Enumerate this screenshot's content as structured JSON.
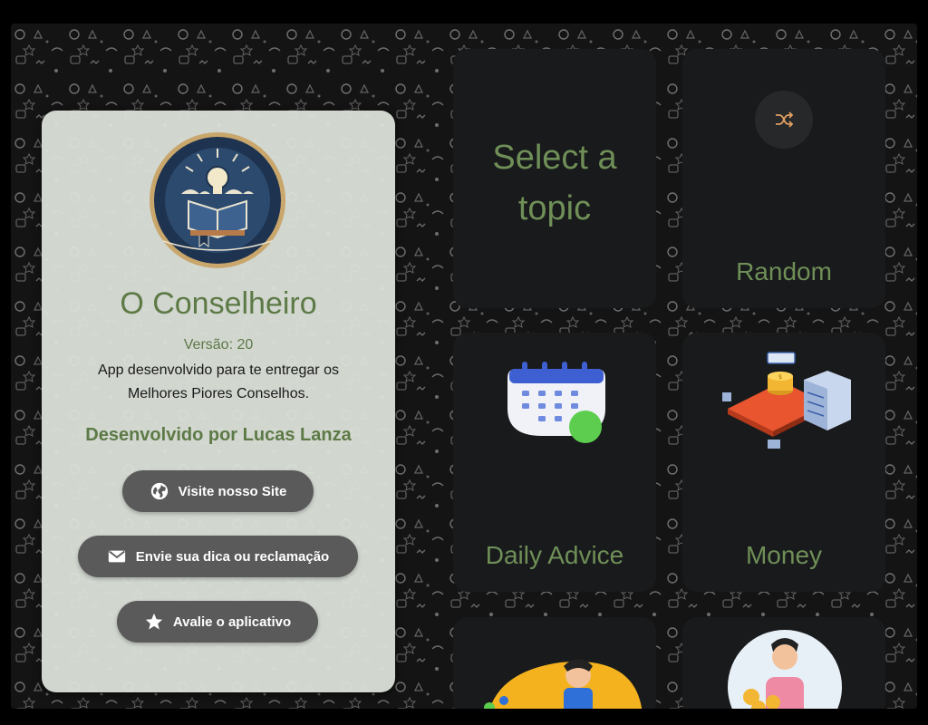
{
  "about": {
    "app_name": "O Conselheiro",
    "version": "Versão: 20",
    "description_line1": "App desenvolvido para te entregar os",
    "description_line2": "Melhores Piores Conselhos.",
    "developer": "Desenvolvido por Lucas Lanza",
    "buttons": {
      "site": {
        "label": "Visite nosso Site",
        "icon": "globe-icon"
      },
      "feedback": {
        "label": "Envie sua dica ou reclamação",
        "icon": "mail-icon"
      },
      "rate": {
        "label": "Avalie o aplicativo",
        "icon": "star-icon"
      }
    }
  },
  "tiles": {
    "select_line1": "Select a",
    "select_line2": "topic",
    "random": {
      "label": "Random",
      "icon": "shuffle-icon"
    },
    "daily": {
      "label": "Daily Advice",
      "icon": "calendar-icon"
    },
    "money": {
      "label": "Money",
      "icon": "money-server-illustration"
    }
  },
  "colors": {
    "accent_green": "#6f8f57",
    "card_bg": "#dde2db",
    "tile_bg": "#181a1c",
    "button_bg": "#5a5a5a"
  }
}
